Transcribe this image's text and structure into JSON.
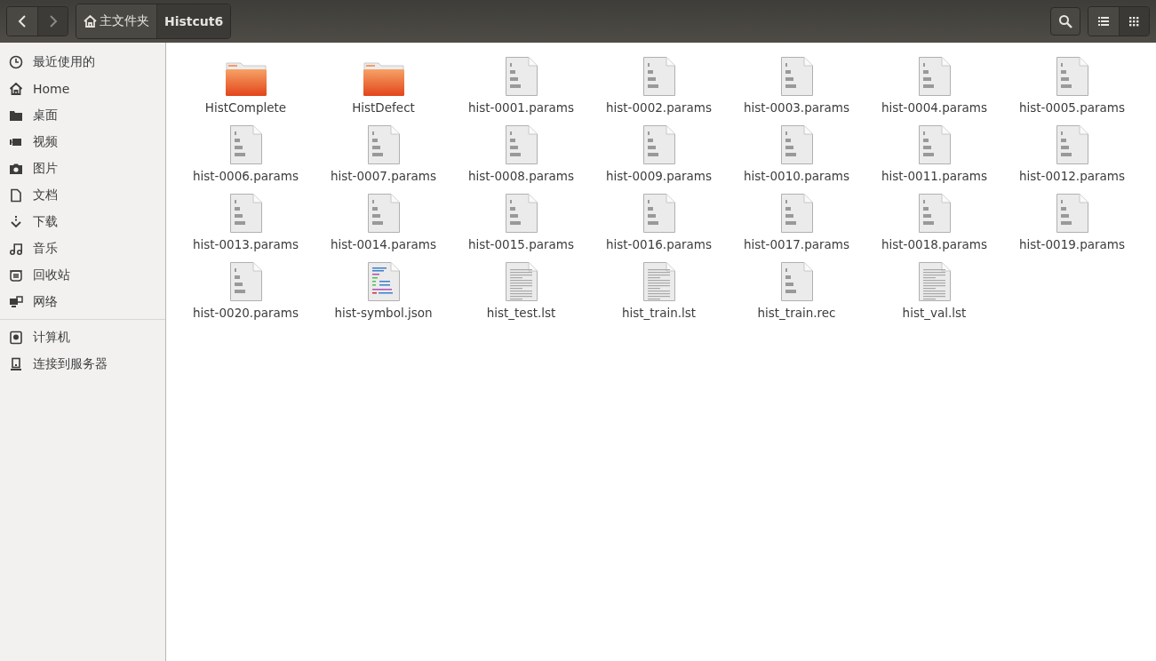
{
  "toolbar": {
    "back_enabled": true,
    "forward_enabled": false,
    "view_buttons": [
      {
        "kind": "list",
        "selected": false
      },
      {
        "kind": "grid",
        "selected": true
      }
    ]
  },
  "breadcrumb": [
    {
      "label": "主文件夹",
      "kind": "home",
      "selected": false
    },
    {
      "label": "Histcut6",
      "kind": "folder",
      "selected": true
    }
  ],
  "sidebar": {
    "sections": [
      [
        {
          "label": "最近使用的",
          "kind": "recent"
        },
        {
          "label": "Home",
          "kind": "home"
        },
        {
          "label": "桌面",
          "kind": "desktop"
        },
        {
          "label": "视频",
          "kind": "video"
        },
        {
          "label": "图片",
          "kind": "picture"
        },
        {
          "label": "文档",
          "kind": "document"
        },
        {
          "label": "下载",
          "kind": "download"
        },
        {
          "label": "音乐",
          "kind": "music"
        },
        {
          "label": "回收站",
          "kind": "trash"
        },
        {
          "label": "网络",
          "kind": "network"
        }
      ],
      [
        {
          "label": "计算机",
          "kind": "computer"
        },
        {
          "label": "连接到服务器",
          "kind": "server"
        }
      ]
    ]
  },
  "files": [
    {
      "name": "HistComplete",
      "kind": "folder"
    },
    {
      "name": "HistDefect",
      "kind": "folder"
    },
    {
      "name": "hist-0001.params",
      "kind": "binary"
    },
    {
      "name": "hist-0002.params",
      "kind": "binary"
    },
    {
      "name": "hist-0003.params",
      "kind": "binary"
    },
    {
      "name": "hist-0004.params",
      "kind": "binary"
    },
    {
      "name": "hist-0005.params",
      "kind": "binary"
    },
    {
      "name": "hist-0006.params",
      "kind": "binary"
    },
    {
      "name": "hist-0007.params",
      "kind": "binary"
    },
    {
      "name": "hist-0008.params",
      "kind": "binary"
    },
    {
      "name": "hist-0009.params",
      "kind": "binary"
    },
    {
      "name": "hist-0010.params",
      "kind": "binary"
    },
    {
      "name": "hist-0011.params",
      "kind": "binary"
    },
    {
      "name": "hist-0012.params",
      "kind": "binary"
    },
    {
      "name": "hist-0013.params",
      "kind": "binary"
    },
    {
      "name": "hist-0014.params",
      "kind": "binary"
    },
    {
      "name": "hist-0015.params",
      "kind": "binary"
    },
    {
      "name": "hist-0016.params",
      "kind": "binary"
    },
    {
      "name": "hist-0017.params",
      "kind": "binary"
    },
    {
      "name": "hist-0018.params",
      "kind": "binary"
    },
    {
      "name": "hist-0019.params",
      "kind": "binary"
    },
    {
      "name": "hist-0020.params",
      "kind": "binary"
    },
    {
      "name": "hist-symbol.json",
      "kind": "code"
    },
    {
      "name": "hist_test.lst",
      "kind": "text"
    },
    {
      "name": "hist_train.lst",
      "kind": "text"
    },
    {
      "name": "hist_train.rec",
      "kind": "binary"
    },
    {
      "name": "hist_val.lst",
      "kind": "text"
    }
  ]
}
